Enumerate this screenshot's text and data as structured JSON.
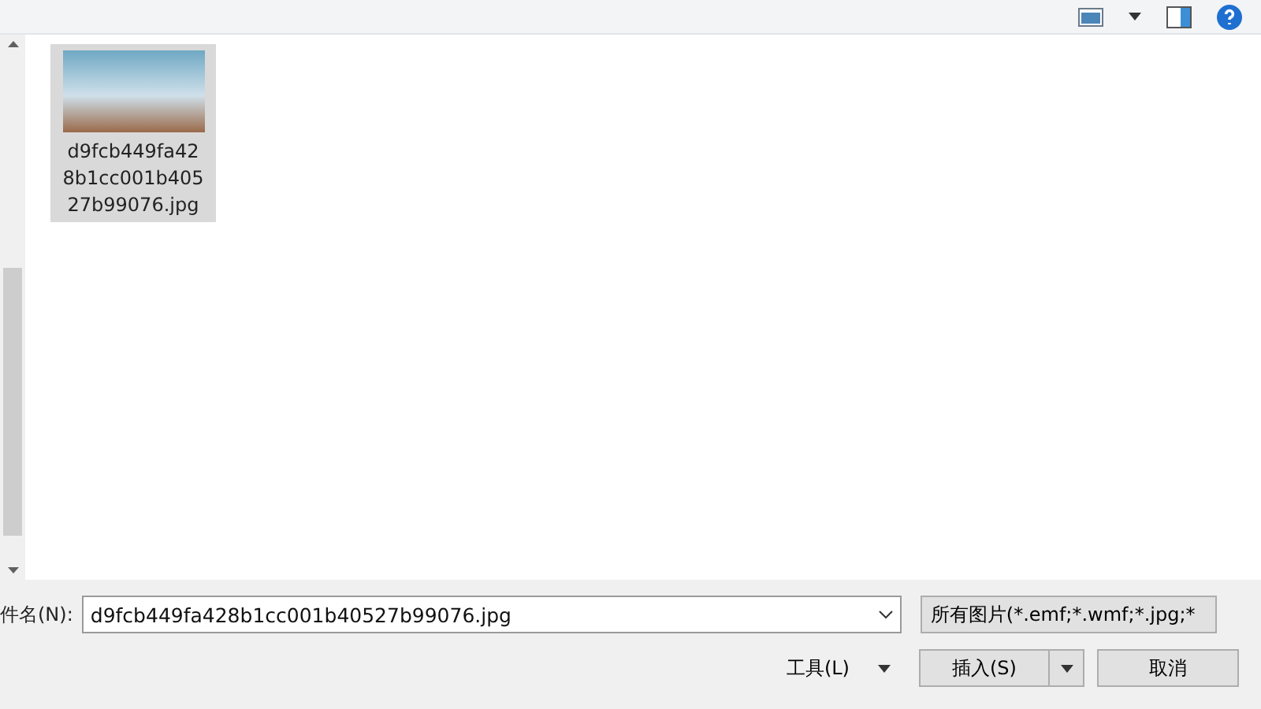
{
  "files": [
    {
      "name": "d9fcb449fa428b1cc001b40527b99076.jpg",
      "selected": true
    }
  ],
  "filename": {
    "label": "件名(N):",
    "value": "d9fcb449fa428b1cc001b40527b99076.jpg"
  },
  "filter": {
    "value": "所有图片(*.emf;*.wmf;*.jpg;*"
  },
  "tools": {
    "label": "工具(L)"
  },
  "buttons": [
    {
      "label": "插入(S)",
      "kind": "split"
    },
    {
      "label": "取消",
      "kind": "plain"
    }
  ]
}
